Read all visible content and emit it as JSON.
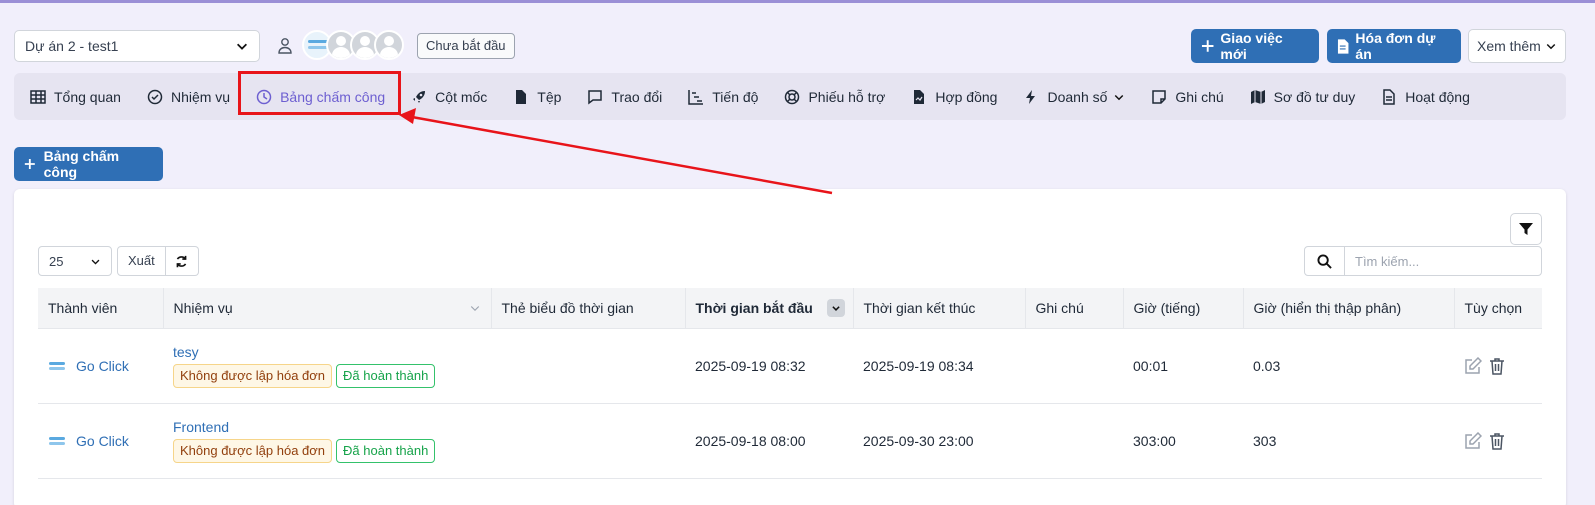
{
  "header": {
    "project_select": "Dự án 2 - test1",
    "status": "Chưa bắt đầu",
    "new_task_button": "Giao việc mới",
    "project_invoice_button": "Hóa đơn dự án",
    "more_button": "Xem thêm"
  },
  "tabs": [
    {
      "label": "Tổng quan",
      "icon": "table-icon"
    },
    {
      "label": "Nhiệm vụ",
      "icon": "check-circle-icon"
    },
    {
      "label": "Bảng chấm công",
      "icon": "clock-icon",
      "active": true
    },
    {
      "label": "Cột mốc",
      "icon": "rocket-icon"
    },
    {
      "label": "Tệp",
      "icon": "file-icon"
    },
    {
      "label": "Trao đổi",
      "icon": "chat-icon"
    },
    {
      "label": "Tiến độ",
      "icon": "gantt-icon"
    },
    {
      "label": "Phiếu hỗ trợ",
      "icon": "lifebuoy-icon"
    },
    {
      "label": "Hợp đồng",
      "icon": "contract-icon"
    },
    {
      "label": "Doanh số",
      "icon": "bolt-icon"
    },
    {
      "label": "Ghi chú",
      "icon": "note-icon"
    },
    {
      "label": "Sơ đồ tư duy",
      "icon": "map-icon"
    },
    {
      "label": "Hoạt động",
      "icon": "activity-icon"
    }
  ],
  "add_timesheet_button": "Bảng chấm công",
  "controls": {
    "page_size": "25",
    "export_button": "Xuất",
    "search_placeholder": "Tìm kiếm..."
  },
  "table": {
    "columns": [
      "Thành viên",
      "Nhiệm vụ",
      "Thẻ biểu đồ thời gian",
      "Thời gian bắt đầu",
      "Thời gian kết thúc",
      "Ghi chú",
      "Giờ (tiếng)",
      "Giờ (hiển thị thập phân)",
      "Tùy chọn"
    ],
    "rows": [
      {
        "member": "Go Click",
        "task": "tesy",
        "badge_billing": "Không được lập hóa đơn",
        "badge_status": "Đã hoàn thành",
        "tags": "",
        "start": "2025-09-19 08:32",
        "end": "2025-09-19 08:34",
        "note": "",
        "hours": "00:01",
        "hours_decimal": "0.03"
      },
      {
        "member": "Go Click",
        "task": "Frontend",
        "badge_billing": "Không được lập hóa đơn",
        "badge_status": "Đã hoàn thành",
        "tags": "",
        "start": "2025-09-18 08:00",
        "end": "2025-09-30 23:00",
        "note": "",
        "hours": "303:00",
        "hours_decimal": "303"
      }
    ]
  },
  "colors": {
    "primary": "#2f6fb5",
    "active_tab": "#6d5fd1",
    "highlight": "#e8141a"
  }
}
